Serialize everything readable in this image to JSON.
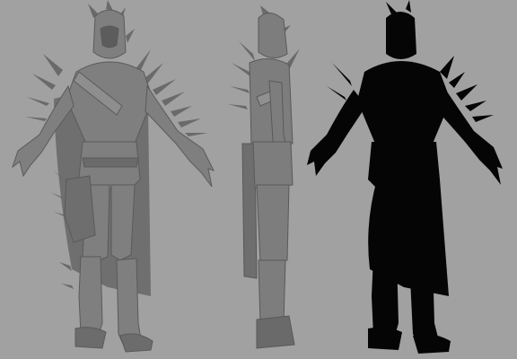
{
  "scene": {
    "background_color": "#a1a1a1",
    "views": [
      {
        "name": "front-view",
        "shading": "grey",
        "color": "#7f7f7f",
        "shadow": "#5a5a5a",
        "highlight": "#9a9a9a"
      },
      {
        "name": "side-view",
        "shading": "grey",
        "color": "#7d7d7d",
        "shadow": "#595959",
        "highlight": "#999999"
      },
      {
        "name": "silhouette-view",
        "shading": "silhouette",
        "color": "#050505"
      }
    ]
  }
}
